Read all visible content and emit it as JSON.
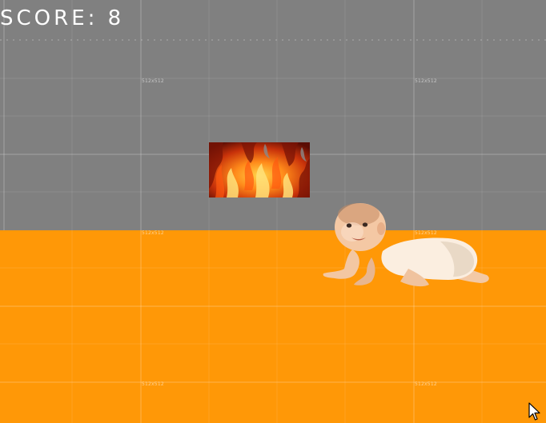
{
  "hud": {
    "score_label": "SCORE:",
    "score_value": "8"
  },
  "scene": {
    "sky_color": "#808080",
    "ground_color": "#FF9807",
    "grid_labels": [
      "512x512",
      "512x512",
      "512x512",
      "512x512",
      "512x512",
      "512x512"
    ]
  },
  "sprites": {
    "obstacle": "fire-block",
    "player": "crawling-baby"
  },
  "cursor": "arrow-cursor-icon"
}
